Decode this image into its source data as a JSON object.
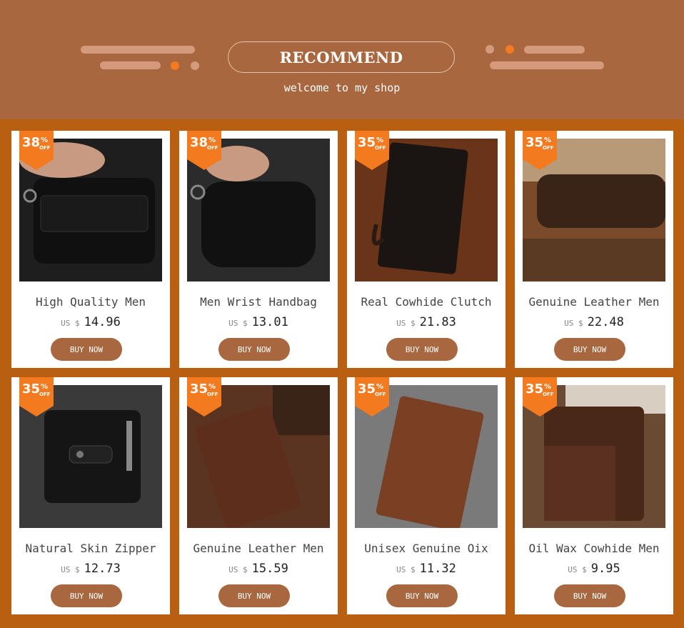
{
  "header": {
    "title": "RECOMMEND",
    "subtitle": "welcome to my shop"
  },
  "colors": {
    "background": "#b85f12",
    "header_bg": "#a8673e",
    "badge": "#f47a20",
    "button": "#a8673e"
  },
  "products": [
    {
      "discount": "38",
      "pct": "%",
      "off": "OFF",
      "title": "High Quality Men",
      "currency": "US $",
      "price": "14.96",
      "button": "BUY NOW",
      "image": "black-zip-wallet-hand-icon"
    },
    {
      "discount": "38",
      "pct": "%",
      "off": "OFF",
      "title": "Men Wrist Handbag",
      "currency": "US $",
      "price": "13.01",
      "button": "BUY NOW",
      "image": "black-clutch-hand-icon"
    },
    {
      "discount": "35",
      "pct": "%",
      "off": "OFF",
      "title": "Real Cowhide Clutch",
      "currency": "US $",
      "price": "21.83",
      "button": "BUY NOW",
      "image": "black-long-clutch-icon"
    },
    {
      "discount": "35",
      "pct": "%",
      "off": "OFF",
      "title": "Genuine Leather Men",
      "currency": "US $",
      "price": "22.48",
      "button": "BUY NOW",
      "image": "brown-zip-wallet-icon"
    },
    {
      "discount": "35",
      "pct": "%",
      "off": "OFF",
      "title": "Natural Skin Zipper",
      "currency": "US $",
      "price": "12.73",
      "button": "BUY NOW",
      "image": "black-bifold-wallet-icon"
    },
    {
      "discount": "35",
      "pct": "%",
      "off": "OFF",
      "title": "Genuine Leather Men",
      "currency": "US $",
      "price": "15.59",
      "button": "BUY NOW",
      "image": "brown-long-wallet-icon"
    },
    {
      "discount": "35",
      "pct": "%",
      "off": "OFF",
      "title": "Unisex Genuine Oix",
      "currency": "US $",
      "price": "11.32",
      "button": "BUY NOW",
      "image": "brown-slim-wallet-icon"
    },
    {
      "discount": "35",
      "pct": "%",
      "off": "OFF",
      "title": "Oil Wax Cowhide Men",
      "currency": "US $",
      "price": "9.95",
      "button": "BUY NOW",
      "image": "brown-trifold-wallet-icon"
    }
  ]
}
